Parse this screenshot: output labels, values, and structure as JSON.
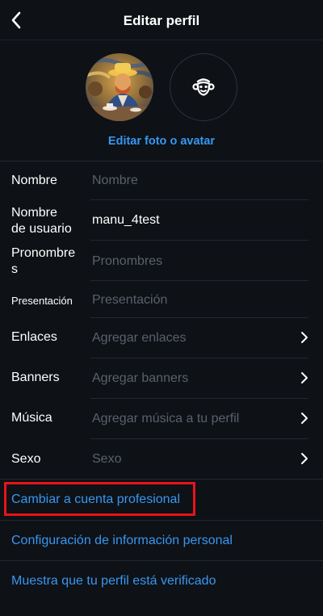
{
  "header": {
    "title": "Editar perfil"
  },
  "avatar": {
    "edit_link": "Editar foto o avatar"
  },
  "fields": [
    {
      "label_line1": "Nombre",
      "label_line2": "",
      "value": "",
      "placeholder": "Nombre"
    },
    {
      "label_line1": "Nombre",
      "label_line2": "de usuario",
      "value": "manu_4test",
      "placeholder": ""
    },
    {
      "label_line1": "Pronombre",
      "label_line2": "s",
      "value": "",
      "placeholder": "Pronombres"
    },
    {
      "label_line1": "Presentación",
      "label_line2": "",
      "value": "",
      "placeholder": "Presentación"
    },
    {
      "label_line1": "Enlaces",
      "label_line2": "",
      "value": "",
      "placeholder": "Agregar enlaces"
    },
    {
      "label_line1": "Banners",
      "label_line2": "",
      "value": "",
      "placeholder": "Agregar banners"
    },
    {
      "label_line1": "Música",
      "label_line2": "",
      "value": "",
      "placeholder": "Agregar música a tu perfil"
    },
    {
      "label_line1": "Sexo",
      "label_line2": "",
      "value": "",
      "placeholder": "Sexo"
    }
  ],
  "links": [
    {
      "label": "Cambiar a cuenta profesional"
    },
    {
      "label": "Configuración de información personal"
    },
    {
      "label": "Muestra que tu perfil está verificado"
    }
  ],
  "colors": {
    "background": "#0e1116",
    "link_blue": "#3797f0",
    "placeholder_gray": "#5a616b",
    "highlight_red": "#e8131a"
  },
  "icons": {
    "back": "chevron-left-icon",
    "avatar": "monkey-face-icon",
    "row_arrow": "chevron-right-icon"
  }
}
